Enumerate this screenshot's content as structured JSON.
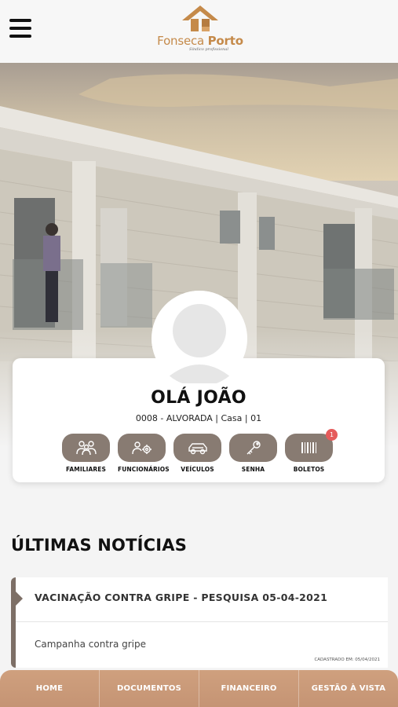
{
  "header": {
    "logo_name_a": "Fonseca",
    "logo_name_b": "Porto",
    "logo_tagline": "Síndico profissional"
  },
  "profile": {
    "greeting": "OLÁ JOÃO",
    "unit": "0008 - ALVORADA | Casa | 01",
    "actions": [
      {
        "label": "FAMILIARES",
        "icon": "family-icon"
      },
      {
        "label": "FUNCIONÁRIOS",
        "icon": "staff-gears-icon"
      },
      {
        "label": "VEÍCULOS",
        "icon": "car-icon"
      },
      {
        "label": "SENHA",
        "icon": "key-icon"
      },
      {
        "label": "BOLETOS",
        "icon": "barcode-icon",
        "badge": "1"
      }
    ]
  },
  "news": {
    "section_title": "ÚLTIMAS NOTÍCIAS",
    "items": [
      {
        "title": "VACINAÇÃO CONTRA GRIPE - PESQUISA 05-04-2021",
        "body": "Campanha contra gripe",
        "date": "CADASTRADO EM: 05/04/2021"
      }
    ]
  },
  "bottom_nav": {
    "items": [
      "HOME",
      "DOCUMENTOS",
      "FINANCEIRO",
      "GESTÃO À VISTA"
    ]
  },
  "colors": {
    "accent_brown": "#887b72",
    "brand_copper": "#c58a4a",
    "nav_bg": "#c99a79",
    "badge_red": "#e55b5b"
  }
}
